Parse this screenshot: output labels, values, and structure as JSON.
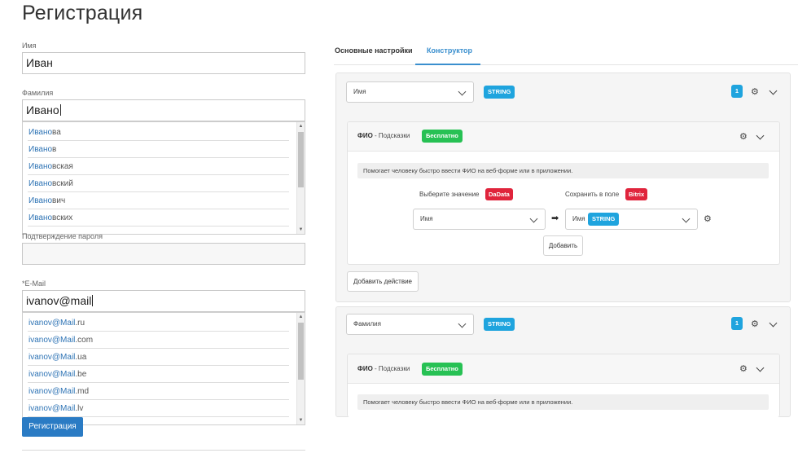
{
  "form": {
    "title": "Регистрация",
    "name_label": "Имя",
    "name_value": "Иван",
    "surname_label": "Фамилия",
    "surname_value": "Ивано",
    "surname_suggestions": [
      {
        "hl": "Ивано",
        "rest": "ва"
      },
      {
        "hl": "Ивано",
        "rest": "в"
      },
      {
        "hl": "Ивано",
        "rest": "вская"
      },
      {
        "hl": "Ивано",
        "rest": "вский"
      },
      {
        "hl": "Ивано",
        "rest": "вич"
      },
      {
        "hl": "Ивано",
        "rest": "вских"
      }
    ],
    "password_confirm_label": "Подтверждение пароля",
    "password_confirm_value": "",
    "email_label": "*E-Mail",
    "email_value": "ivanov@mail",
    "email_suggestions": [
      {
        "hl": "ivanov@Mail",
        "rest": ".ru"
      },
      {
        "hl": "ivanov@Mail",
        "rest": ".com"
      },
      {
        "hl": "ivanov@Mail",
        "rest": ".ua"
      },
      {
        "hl": "ivanov@Mail",
        "rest": ".be"
      },
      {
        "hl": "ivanov@Mail",
        "rest": ".md"
      },
      {
        "hl": "ivanov@Mail",
        "rest": ".lv"
      }
    ],
    "register_button": "Регистрация"
  },
  "tabs": [
    {
      "label": "Основные настройки",
      "active": false
    },
    {
      "label": "Конструктор",
      "active": true
    }
  ],
  "constructor": {
    "block1": {
      "field_select": "Имя",
      "type_badge": "STRING",
      "count": "1",
      "card": {
        "title": "ФИО",
        "subtitle": " - Подсказки",
        "free_badge": "Бесплатно",
        "hint": "Помогает человеку быстро ввести ФИО на веб-форме или в приложении.",
        "choose_label": "Выберите значение",
        "choose_badge": "DaData",
        "save_label": "Сохранить в поле",
        "save_badge": "Bitrix",
        "source_select": "Имя",
        "target_select": "Имя",
        "target_badge": "STRING",
        "add_button": "Добавить"
      },
      "add_action_button": "Добавить действие"
    },
    "block2": {
      "field_select": "Фамилия",
      "type_badge": "STRING",
      "count": "1",
      "card": {
        "title": "ФИО",
        "subtitle": " - Подсказки",
        "free_badge": "Бесплатно",
        "hint": "Помогает человеку быстро ввести ФИО на веб-форме или в приложении."
      }
    }
  },
  "colors": {
    "accent": "#3a8fce",
    "string_badge": "#1fa4de",
    "free_badge": "#27c154",
    "red_badge": "#e0243c",
    "primary_button": "#2a7bc4"
  },
  "icons": {
    "gear": "gear-icon",
    "chevron": "chevron-down-icon",
    "arrow": "arrow-right-icon"
  }
}
